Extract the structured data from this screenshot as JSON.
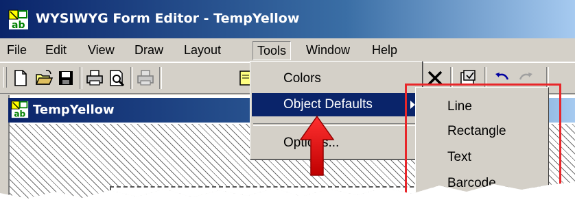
{
  "window": {
    "title": "WYSIWYG Form Editor - TempYellow"
  },
  "menubar": {
    "items": [
      {
        "label": "File"
      },
      {
        "label": "Edit"
      },
      {
        "label": "View"
      },
      {
        "label": "Draw"
      },
      {
        "label": "Layout"
      },
      {
        "label": "Tools"
      },
      {
        "label": "Window"
      },
      {
        "label": "Help"
      }
    ],
    "open_menu": "Tools"
  },
  "toolbar": {
    "buttons": [
      "new-icon",
      "open-folder-icon",
      "save-icon",
      "print-icon",
      "print-preview-icon",
      "disabled-print-icon",
      "object-icon",
      "delete-icon",
      "properties-icon",
      "undo-icon",
      "redo-icon"
    ]
  },
  "document": {
    "title": "TempYellow"
  },
  "tools_menu": {
    "items": [
      {
        "label": "Colors",
        "selected": false,
        "submenu": false
      },
      {
        "label": "Object Defaults",
        "selected": true,
        "submenu": true
      },
      {
        "label": "Options...",
        "selected": false,
        "submenu": false
      }
    ]
  },
  "object_defaults_submenu": {
    "items": [
      {
        "label": "Line"
      },
      {
        "label": "Rectangle"
      },
      {
        "label": "Text"
      },
      {
        "label": "Barcode"
      }
    ]
  },
  "colors": {
    "title_gradient_start": "#0a246a",
    "selection": "#0a246a",
    "annotation_red": "#e8262a",
    "face": "#d4d0c8"
  }
}
